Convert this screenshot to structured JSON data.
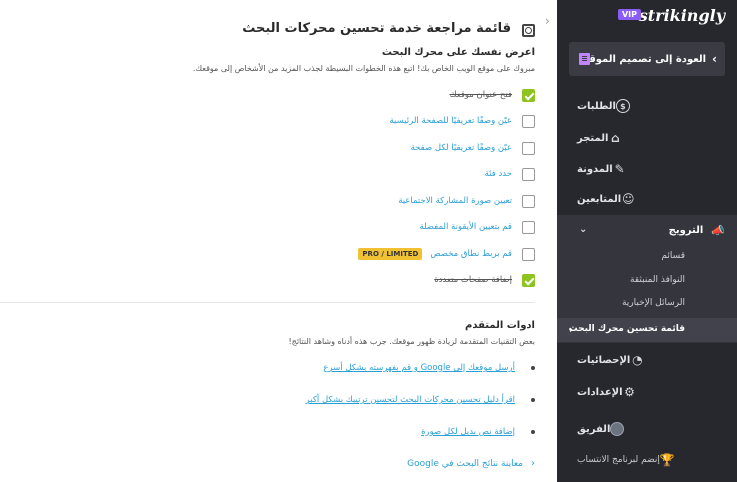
{
  "sidebar": {
    "logo": "strikingly",
    "vip_badge": "VIP",
    "collapse_glyph": "‹",
    "back_button": "العودة إلى تصميم الموقع",
    "items": [
      {
        "label": "الطلبات",
        "icon": "dollar-circle-icon",
        "glyph": "$"
      },
      {
        "label": "المتجر",
        "icon": "store-icon",
        "glyph": "⌂"
      },
      {
        "label": "المدونة",
        "icon": "pen-icon",
        "glyph": "✎"
      },
      {
        "label": "المتابعين",
        "icon": "users-icon",
        "glyph": "☺"
      }
    ],
    "promotion": {
      "label": "الترويج",
      "icon": "megaphone-icon",
      "glyph": "📣",
      "sub_items": [
        "قسائم",
        "النوافذ المنبثقة",
        "الرسائل الإخبارية"
      ],
      "active_sub_item": "قائمة تحسين محرك البحث"
    },
    "stats": {
      "label": "الإحصائيات",
      "icon": "stats-icon",
      "glyph": "◔"
    },
    "settings": {
      "label": "الإعدادات",
      "icon": "gear-icon",
      "glyph": "⚙"
    },
    "team": {
      "label": "الفريق",
      "icon": "team-avatar-icon"
    },
    "affiliate": {
      "label": "إنضم لبرنامج الانتساب",
      "icon": "trophy-icon",
      "glyph": "🏆"
    }
  },
  "main": {
    "title": "قائمة مراجعة خدمة تحسين محركات البحث",
    "section1": {
      "heading": "اعرض نفسك على محرك البحث",
      "description": "مبروك على موقع الويب الخاص بك! اتبع هذه الخطوات البسيطة لجذب المزيد من الأشخاص إلى موقعك.",
      "tasks": [
        {
          "label": "فتح عنوان موقعك",
          "done": true
        },
        {
          "label": "عيّن وصفًا تعريفيًا للصفحة الرئيسية",
          "done": false
        },
        {
          "label": "عيّن وصفًا تعريفيًا لكل صفحة",
          "done": false
        },
        {
          "label": "حدد فئة",
          "done": false
        },
        {
          "label": "تعيين صورة المشاركة الاجتماعية",
          "done": false
        },
        {
          "label": "قم بتعيين الأيقونة المفضلة",
          "done": false
        },
        {
          "label": "قم بربط نطاق مخصص",
          "done": false,
          "badge": "PRO / LIMITED"
        },
        {
          "label": "إضافة صفحات متعددة",
          "done": true
        }
      ]
    },
    "section2": {
      "heading": "ادوات المتقدم",
      "description": "بعض التقنيات المتقدمة لزيادة ظهور موقعك. جرب هذه أدناه وشاهد النتائج!",
      "links": [
        "أرسل موقعك إلى Google و قم بفهرسته بشكل أسرع",
        "اقرأ دليل تحسين محركات البحث لتحسين ترتيبك بشكل أكبر",
        "إضافة نص بديل لكل صورة"
      ],
      "preview_link": "معاينة نتائج البحث في Google"
    }
  },
  "colors": {
    "sidebar_bg": "#27282e",
    "accent_link": "#2a9fd6",
    "check_green": "#8fc31f",
    "badge_yellow": "#f0c233",
    "vip_purple": "#8b5cf6"
  }
}
